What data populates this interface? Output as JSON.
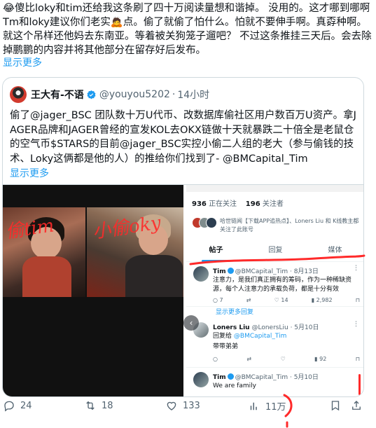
{
  "post": {
    "text": "😂傻比loky和tim还给我这条刷了四十万阅读量想和谐掉。 没用的。这才哪到哪啊Tm和loky建议你们老实🙇点。偷了就偷了怕什么。怕就不要伸手啊。真孬种啊。就这个吊样还他妈去东南亚。等着被关狗笼子遛吧？ 不过这条推挂三天后。会去除掉鹏鹏的内容并将其他部分在留存好后发布。",
    "show_more": "显示更多"
  },
  "quote": {
    "name": "王大有-不语",
    "handle": "@youyou5202",
    "dot": "·",
    "time": "14小时",
    "body": "偷了@jager_BSC 团队数十万U代币、改数据库偷社区用户数百万U资产。拿JAGER品牌和JAGER曾经的宣发KOL去OKX链做十天就暴跌二十倍全是老鼠仓的空气币$STARS的目前@jager_BSC实控小偷二人组的老大（参与偷钱的技术、Loky这俩都是他的人）的推给你们找到了- @BMCapital_Tim",
    "show_more": "显示更多",
    "media": {
      "photo_left_scribble": "偷tim",
      "photo_right_scribble": "小偷oky",
      "screenshot": {
        "following_count": "936",
        "following_label": "正在关注",
        "followers_count": "196",
        "followers_label": "关注者",
        "mutual_text": "哈世链闻【下载APP追热点】、Loners Liu 和 K线教主都关注了此账号",
        "tabs": [
          "帖子",
          "回复",
          "媒体"
        ],
        "tweets": [
          {
            "name": "Tim",
            "handle": "@BMCapital_Tim",
            "date": "· 8月13日",
            "body": "注意力，是我们真正拥有的筹码，作为一种稀缺资源，每个人注意力的承载负荷，都是十分有效",
            "replies": "7",
            "retweets": "",
            "likes": "14",
            "views": "2,982"
          },
          {
            "name": "Loners Liu",
            "handle": "@LonersLiu",
            "date": "· 5月10日",
            "reply_to_label": "回复给",
            "reply_to": "@BMCapital_Tim",
            "body": "带带弟弟",
            "views": "92"
          },
          {
            "name": "Tim",
            "handle": "@BMCapital_Tim",
            "date": "· 5月10日",
            "body": "We are family"
          }
        ],
        "show_replies": "显示更多回复"
      }
    }
  },
  "actions": {
    "replies": "24",
    "retweets": "18",
    "likes": "133",
    "views": "11万"
  },
  "colors": {
    "accent": "#1d9bf0",
    "muted": "#536471",
    "annotation_red": "#ff2a2a"
  }
}
